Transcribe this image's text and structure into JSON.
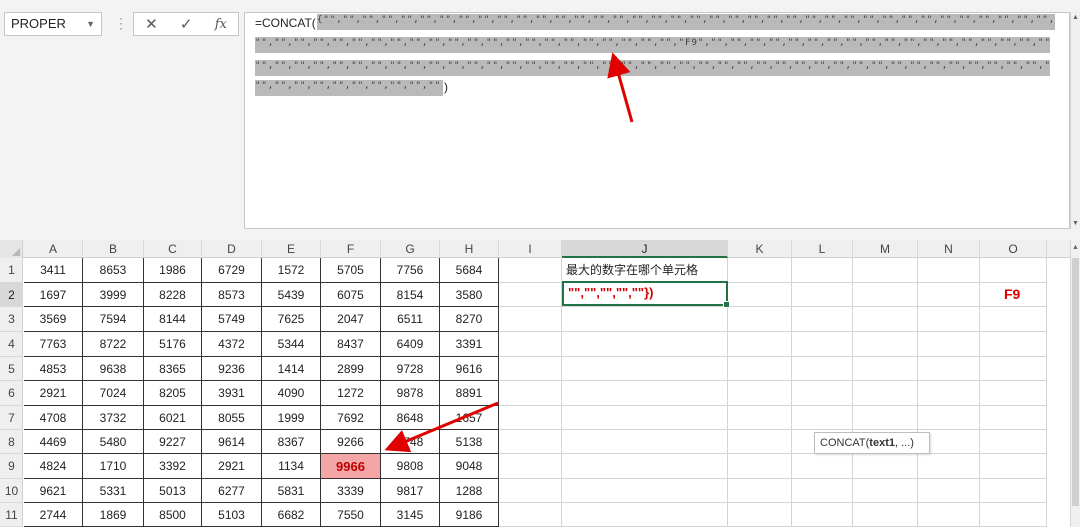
{
  "name_box": {
    "value": "PROPER",
    "dropdown_icon": "chevron-down-icon"
  },
  "formula_buttons": {
    "cancel_icon": "close-icon",
    "enter_icon": "check-icon",
    "fx_label": "fx"
  },
  "formula_bar": {
    "prefix": "=CONCAT(",
    "open_brace": "{",
    "highlight_line1": "\"\",\"\",\"\",\"\",\"\",\"\",\"\",\"\",\"\",\"\",\"\",\"\",\"\",\"\",\"\",\"\",\"\",\"\",\"\",\"\",\"\",\"\",\"\",\"\",\"\",\"\",\"\",\"\",\"\",\"\",\"\",\"\",\"\",\"\",\"\",\"\",\"\",\"\",\"\",\"\",\"\",\"\",\"\",",
    "highlight_line2": "\"\",\"\",\"\",\"\",\"\",\"\",\"\",\"\",\"\",\"\",\"\",\"\",\"\",\"\",\"\",\"\",\"\",\"\",\"\",\"\",\"\",\"\",\"F9\",\"\",\"\",\"\",\"\",\"\",\"\",\"\",\"\",\"\",\"\",\"\",\"\",\"\",\"\",\"\",\"\",\"\",\"\",\"\",\"\",\"\",\"\",",
    "highlight_line3": "\"\",\"\",\"\",\"\",\"\",\"\",\"\",\"\",\"\",\"\",\"\",\"\",\"\",\"\",\"\",\"\",\"\",\"\",\"\",\"\",\"\",\"\",\"\",\"\",\"\",\"\",\"\",\"\",\"\",\"\",\"\",\"\",\"\",\"\",\"\",\"\",\"\",\"\",\"\",\"\",\"\",\"\",\"\",",
    "highlight_line4": "\"\",\"\",\"\",\"\",\"\",\"\",\"\",\"\",\"\",\"\",\"\",\"\",\"\"}",
    "closing": ")"
  },
  "columns": [
    "A",
    "B",
    "C",
    "D",
    "E",
    "F",
    "G",
    "H",
    "I",
    "J",
    "K",
    "L",
    "M",
    "N",
    "O"
  ],
  "selected_column": "J",
  "rows": [
    "1",
    "2",
    "3",
    "4",
    "5",
    "6",
    "7",
    "8",
    "9",
    "10",
    "11"
  ],
  "selected_row": "2",
  "table": [
    [
      "3411",
      "8653",
      "1986",
      "6729",
      "1572",
      "5705",
      "7756",
      "5684"
    ],
    [
      "1697",
      "3999",
      "8228",
      "8573",
      "5439",
      "6075",
      "8154",
      "3580"
    ],
    [
      "3569",
      "7594",
      "8144",
      "5749",
      "7625",
      "2047",
      "6511",
      "8270"
    ],
    [
      "7763",
      "8722",
      "5176",
      "4372",
      "5344",
      "8437",
      "6409",
      "3391"
    ],
    [
      "4853",
      "9638",
      "8365",
      "9236",
      "1414",
      "2899",
      "9728",
      "9616"
    ],
    [
      "2921",
      "7024",
      "8205",
      "3931",
      "4090",
      "1272",
      "9878",
      "8891"
    ],
    [
      "4708",
      "3732",
      "6021",
      "8055",
      "1999",
      "7692",
      "8648",
      "1657"
    ],
    [
      "4469",
      "5480",
      "9227",
      "9614",
      "8367",
      "9266",
      "9748",
      "5138"
    ],
    [
      "4824",
      "1710",
      "3392",
      "2921",
      "1134",
      "9966",
      "9808",
      "9048"
    ],
    [
      "9621",
      "5331",
      "5013",
      "6277",
      "5831",
      "3339",
      "9817",
      "1288"
    ],
    [
      "2744",
      "1869",
      "8500",
      "5103",
      "6682",
      "7550",
      "3145",
      "9186"
    ]
  ],
  "max_cell": {
    "row": 9,
    "col": "F",
    "value": "9966"
  },
  "j1_text": "最大的数字在哪个单元格",
  "j2_text": "\"\",\"\",\"\",\"\",\"\"})",
  "f9_label": "F9",
  "tooltip": {
    "func": "CONCAT(",
    "arg": "text1",
    "rest": ", ...)"
  },
  "colors": {
    "accent": "#217346",
    "highlight": "#f4a6a6",
    "annotation_red": "#e00000"
  }
}
